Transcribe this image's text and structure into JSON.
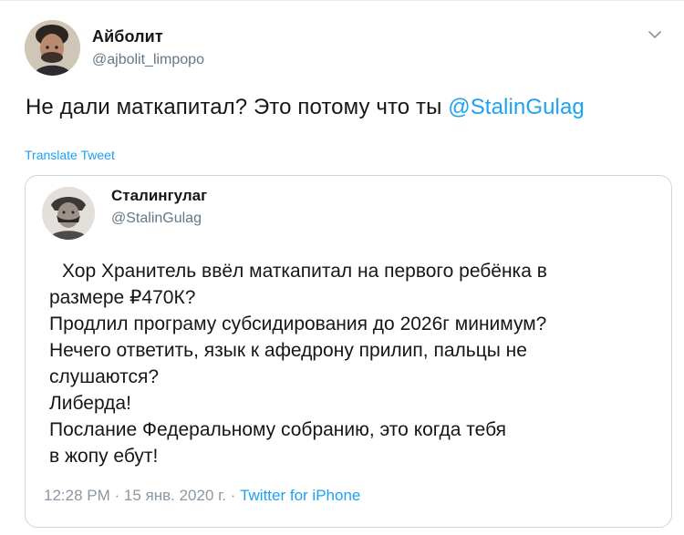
{
  "tweet": {
    "display_name": "Айболит",
    "handle": "@ajbolit_limpopo",
    "text_prefix": "Не дали маткапитал? Это потому что ты ",
    "mention": "@StalinGulag",
    "translate_label": "Translate Tweet",
    "menu_icon": "chevron-down-icon",
    "accent_color": "#1da1f2"
  },
  "quoted": {
    "display_name": "Сталингулаг",
    "handle": "@StalinGulag",
    "lines": [
      "Хор Хранитель ввёл маткапитал на первого ребёнка в",
      "размере ₽470К?",
      "Продлил програму субсидирования до 2026г минимум?",
      "Нечего ответить, язык к афедрону прилип, пальцы не",
      "слушаются?",
      "Либерда!",
      "Послание Федеральному собранию, это когда тебя",
      "в жопу ебут!"
    ],
    "time": "12:28 PM",
    "separator_1": " · ",
    "date": "15 янв. 2020 г.",
    "separator_2": " · ",
    "source": "Twitter for iPhone"
  }
}
